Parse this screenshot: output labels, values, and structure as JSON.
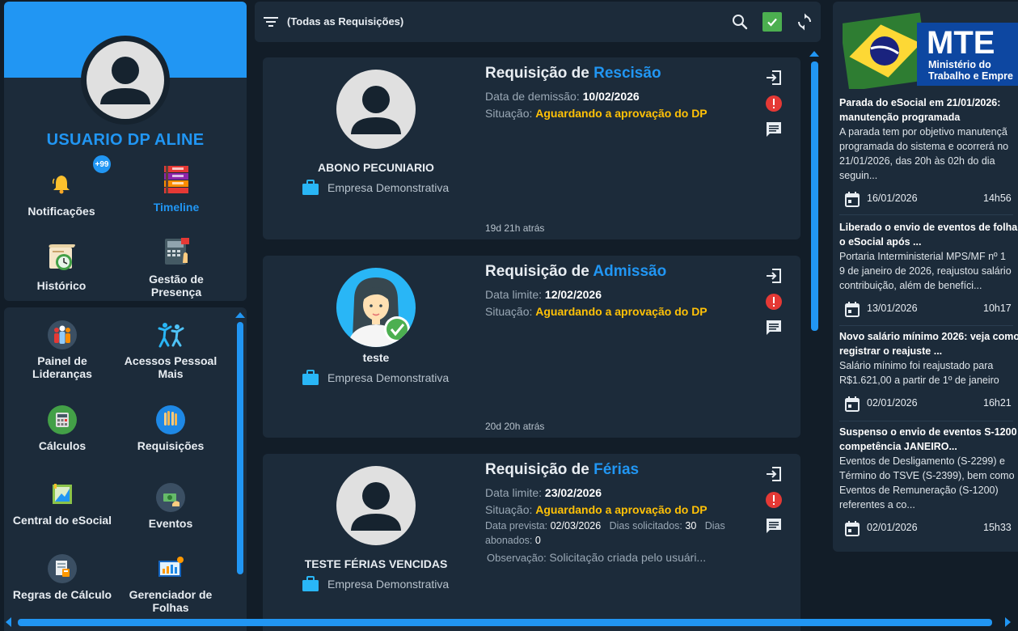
{
  "colors": {
    "accent": "#2196f3",
    "status": "#ffc107",
    "panel": "#1c2b3a",
    "background": "#121d28",
    "ok": "#4caf50",
    "alert": "#e53935"
  },
  "profile": {
    "name": "USUARIO DP ALINE",
    "notifications_badge": "+99",
    "shortcuts": [
      {
        "label": "Notificações",
        "icon": "bell-icon"
      },
      {
        "label": "Timeline",
        "icon": "timeline-icon",
        "active": true
      },
      {
        "label": "Histórico",
        "icon": "history-icon"
      },
      {
        "label": "Gestão de Presença",
        "icon": "time-clock-icon"
      }
    ]
  },
  "menu": {
    "items": [
      {
        "label": "Painel de Lideranças",
        "icon": "leadership-icon"
      },
      {
        "label": "Acessos Pessoal Mais",
        "icon": "people-access-icon"
      },
      {
        "label": "Cálculos",
        "icon": "calculator-icon"
      },
      {
        "label": "Requisições",
        "icon": "hands-raised-icon"
      },
      {
        "label": "Central do eSocial",
        "icon": "esocial-icon"
      },
      {
        "label": "Eventos",
        "icon": "money-event-icon"
      },
      {
        "label": "Regras de Cálculo",
        "icon": "calc-rules-icon"
      },
      {
        "label": "Gerenciador de Folhas",
        "icon": "payroll-manager-icon"
      }
    ]
  },
  "toolbar": {
    "filter_label": "(Todas as Requisições)",
    "icons": [
      "filter-icon",
      "search-icon",
      "check-icon",
      "refresh-icon"
    ]
  },
  "requests": [
    {
      "title_prefix": "Requisição de",
      "type": "Rescisão",
      "person": "ABONO PECUNIARIO",
      "company": "Empresa Demonstrativa",
      "date_label": "Data de demissão:",
      "date_value": "10/02/2026",
      "status_label": "Situação:",
      "status_value": "Aguardando a aprovação do DP",
      "ago": "19d 21h atrás"
    },
    {
      "title_prefix": "Requisição de",
      "type": "Admissão",
      "person": "teste",
      "company": "Empresa Demonstrativa",
      "date_label": "Data limite:",
      "date_value": "12/02/2026",
      "status_label": "Situação:",
      "status_value": "Aguardando a aprovação do DP",
      "ago": "20d 20h atrás"
    },
    {
      "title_prefix": "Requisição de",
      "type": "Férias",
      "person": "TESTE FÉRIAS VENCIDAS",
      "company": "Empresa Demonstrativa",
      "date_label": "Data limite:",
      "date_value": "23/02/2026",
      "status_label": "Situação:",
      "status_value": "Aguardando a aprovação do DP",
      "planned_label": "Data prevista:",
      "planned_value": "02/03/2026",
      "days_requested_label": "Dias solicitados:",
      "days_requested_value": "30",
      "days_bonus_label": "Dias abonados:",
      "days_bonus_value": "0",
      "note_label": "Observação:",
      "note_value": "Solicitação criada pelo usuári..."
    }
  ],
  "news": {
    "logo": {
      "acronym": "MTE",
      "line1": "Ministério do",
      "line2": "Trabalho e Empre"
    },
    "items": [
      {
        "title_lines": [
          "Parada do eSocial em 21/01/2026:",
          "manutenção programada"
        ],
        "body_lines": [
          "A parada tem por objetivo manutençã",
          "programada do sistema e ocorrerá no",
          "21/01/2026, das 20h às 02h do dia",
          "seguin..."
        ],
        "date": "16/01/2026",
        "time": "14h56"
      },
      {
        "title_lines": [
          "Liberado o envio de eventos de folha",
          "o eSocial após ..."
        ],
        "body_lines": [
          "Portaria Interministerial MPS/MF nº 1",
          "9 de janeiro de 2026, reajustou salário",
          "contribuição, além de benefíci..."
        ],
        "date": "13/01/2026",
        "time": "10h17"
      },
      {
        "title_lines": [
          "Novo salário mínimo 2026: veja como",
          "registrar o reajuste ..."
        ],
        "body_lines": [
          "Salário mínimo foi reajustado para",
          "R$1.621,00 a partir de 1º de janeiro"
        ],
        "date": "02/01/2026",
        "time": "16h21"
      },
      {
        "title_lines": [
          "Suspenso o envio de eventos S-1200",
          "competência JANEIRO..."
        ],
        "body_lines": [
          "Eventos de Desligamento (S-2299) e",
          "Término do TSVE (S-2399), bem como",
          "Eventos de Remuneração (S-1200)",
          "referentes a co..."
        ],
        "date": "02/01/2026",
        "time": "15h33"
      }
    ]
  }
}
